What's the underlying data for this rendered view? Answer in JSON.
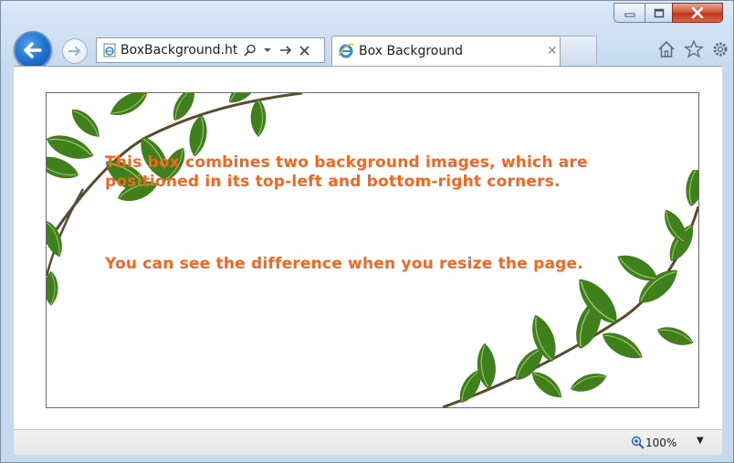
{
  "window": {
    "caption_buttons": [
      "minimize",
      "maximize",
      "close"
    ]
  },
  "address_bar": {
    "url": "BoxBackground.htm",
    "tools": [
      "search-icon",
      "dropdown-icon",
      "go-icon",
      "stop-icon"
    ]
  },
  "tabs": [
    {
      "label": "Box Background",
      "active": true
    }
  ],
  "command_icons": [
    "home-icon",
    "favorites-star-icon",
    "tools-gear-icon"
  ],
  "page": {
    "line1": "This box combines two background images, which are",
    "line2": "positioned in its top-left and bottom-right corners.",
    "line3": "You can see the difference when you resize the page.",
    "text_color": "#f5651f"
  },
  "status_bar": {
    "zoom": "100%"
  },
  "colors": {
    "back_button": "#1d6fce",
    "close_button": "#c2341a",
    "leaf_green": "#3f7f1c"
  }
}
